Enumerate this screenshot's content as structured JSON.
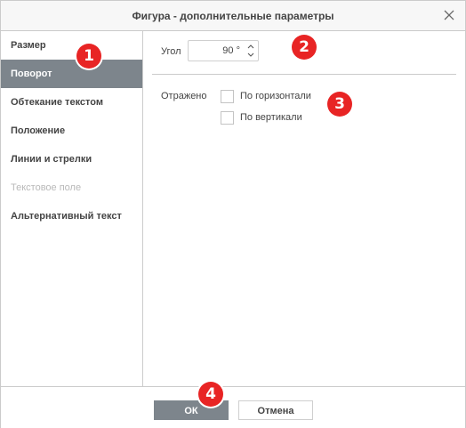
{
  "dialog": {
    "title": "Фигура - дополнительные параметры",
    "close_icon": "close-icon"
  },
  "sidebar": {
    "items": [
      {
        "label": "Размер",
        "state": "normal"
      },
      {
        "label": "Поворот",
        "state": "active"
      },
      {
        "label": "Обтекание текстом",
        "state": "normal"
      },
      {
        "label": "Положение",
        "state": "normal"
      },
      {
        "label": "Линии и стрелки",
        "state": "normal"
      },
      {
        "label": "Текстовое поле",
        "state": "disabled"
      },
      {
        "label": "Альтернативный текст",
        "state": "normal"
      }
    ]
  },
  "rotation": {
    "angle_label": "Угол",
    "angle_value": "90 °",
    "flip_label": "Отражено",
    "flip_horizontal_label": "По горизонтали",
    "flip_vertical_label": "По вертикали",
    "flip_horizontal_checked": false,
    "flip_vertical_checked": false
  },
  "footer": {
    "ok_label": "ОК",
    "cancel_label": "Отмена"
  },
  "annotations": [
    "1",
    "2",
    "3",
    "4"
  ],
  "colors": {
    "active_bg": "#7d858c",
    "badge": "#e82424",
    "border": "#cbcbcb"
  }
}
